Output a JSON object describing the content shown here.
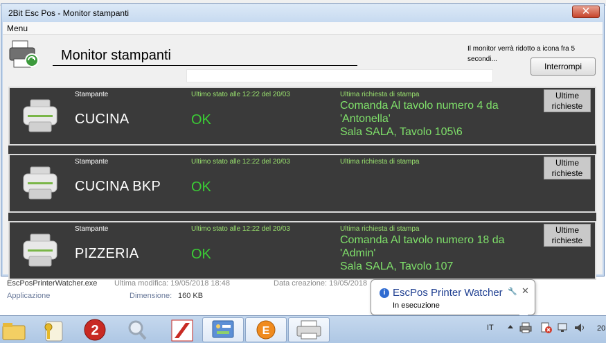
{
  "window": {
    "title": "2Bit Esc Pos - Monitor stampanti",
    "close_label": "✕"
  },
  "menu": {
    "items": [
      "Menu"
    ]
  },
  "header": {
    "title": "Monitor stampanti",
    "countdown_text": "Il monitor verrà ridotto a icona fra 5 secondi...",
    "stop_label": "Interrompi",
    "countdown_progress": 0
  },
  "labels": {
    "printer": "Stampante",
    "status": "Ultimo stato alle 12:22 del 20/03",
    "request": "Ultima richiesta di stampa",
    "recent_button": "Ultime richieste"
  },
  "printers": [
    {
      "name": "CUCINA",
      "status": "OK",
      "request_lines": [
        "Comanda Al tavolo numero 4 da",
        "'Antonella'",
        "Sala SALA, Tavolo 105\\6"
      ]
    },
    {
      "name": "CUCINA BKP",
      "status": "OK",
      "request_lines": []
    },
    {
      "name": "PIZZERIA",
      "status": "OK",
      "request_lines": [
        "Comanda Al tavolo numero 18 da",
        "'Admin'",
        "Sala SALA, Tavolo 107"
      ]
    }
  ],
  "background_explorer": {
    "file_name": "EscPosPrinterWatcher.exe",
    "modified": "Ultima modifica: 19/05/2018 18:48",
    "created": "Data creazione: 19/05/2018",
    "type": "Applicazione",
    "size_label": "Dimensione:",
    "size_value": "160 KB"
  },
  "notification": {
    "title": "EscPos Printer Watcher",
    "message": "In esecuzione",
    "close_label": "✕"
  },
  "taskbar": {
    "buttons": [
      "folder-icon",
      "key-icon",
      "red-circle-2-icon",
      "magnifier-icon",
      "red-logo-icon",
      "control-panel-icon",
      "orange-circle-icon",
      "printer-icon"
    ],
    "language": "IT",
    "clock": "20"
  },
  "colors": {
    "panel_bg": "#3a3a3a",
    "ok_green": "#3bcc35",
    "request_green": "#7fe06a",
    "titlebar": "#c7daf0"
  }
}
